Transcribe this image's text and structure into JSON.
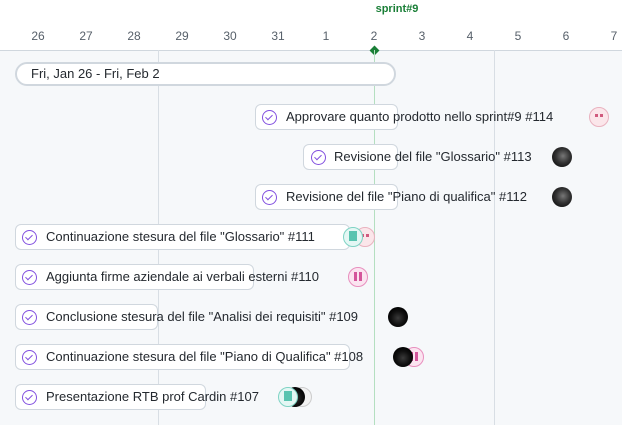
{
  "timeline": {
    "days": [
      "26",
      "27",
      "28",
      "29",
      "30",
      "31",
      "1",
      "2",
      "3",
      "4",
      "5",
      "6",
      "7"
    ],
    "sprint_label": "sprint#9",
    "date_range": "Fri, Jan 26 - Fri, Feb 2"
  },
  "items": [
    {
      "title": "Approvare quanto prodotto nello sprint#9 #114",
      "status_icon": "check-circle-icon",
      "assignees": [
        "pink"
      ]
    },
    {
      "title": "Revisione del file \"Glossario\" #113",
      "status_icon": "check-circle-icon",
      "assignees": [
        "dark"
      ]
    },
    {
      "title": "Revisione del file \"Piano di qualifica\" #112",
      "status_icon": "check-circle-icon",
      "assignees": [
        "dark"
      ]
    },
    {
      "title": "Continuazione stesura del file \"Glossario\" #111",
      "status_icon": "check-circle-icon",
      "assignees": [
        "teal",
        "pink"
      ]
    },
    {
      "title": "Aggiunta firme aziendale ai verbali esterni #110",
      "status_icon": "check-circle-icon",
      "assignees": [
        "magenta"
      ]
    },
    {
      "title": "Conclusione stesura del file \"Analisi dei requisiti\" #109",
      "status_icon": "check-circle-icon",
      "assignees": [
        "black"
      ]
    },
    {
      "title": "Continuazione stesura del file \"Piano di Qualifica\" #108",
      "status_icon": "check-circle-icon",
      "assignees": [
        "black",
        "magenta"
      ]
    },
    {
      "title": "Presentazione RTB prof Cardin #107",
      "status_icon": "check-circle-icon",
      "assignees": [
        "teal",
        "black",
        "light"
      ]
    }
  ],
  "colors": {
    "accent": "#8250df",
    "sprint": "#1a7f37"
  }
}
